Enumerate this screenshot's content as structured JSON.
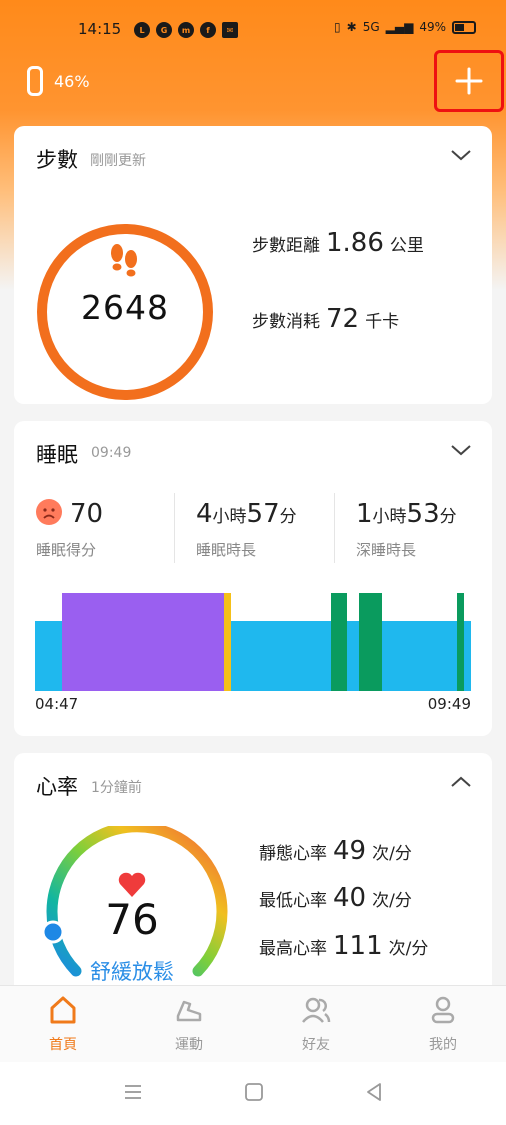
{
  "status_bar": {
    "time": "14:15",
    "notifications": [
      "line",
      "game",
      "messenger",
      "facebook",
      "mail"
    ],
    "network": "5G",
    "battery": "49%"
  },
  "header": {
    "band_battery": "46%",
    "add_icon": "plus-icon"
  },
  "steps_card": {
    "title": "步數",
    "updated": "剛剛更新",
    "count": "2648",
    "distance_label": "步數距離",
    "distance_value": "1.86",
    "distance_unit": "公里",
    "calories_label": "步數消耗",
    "calories_value": "72",
    "calories_unit": "千卡"
  },
  "sleep_card": {
    "title": "睡眠",
    "time": "09:49",
    "score": "70",
    "score_label": "睡眠得分",
    "duration_h": "4",
    "duration_h_unit": "小時",
    "duration_m": "57",
    "duration_m_unit": "分",
    "duration_label": "睡眠時長",
    "deep_h": "1",
    "deep_h_unit": "小時",
    "deep_m": "53",
    "deep_m_unit": "分",
    "deep_label": "深睡時長",
    "start_time": "04:47",
    "end_time": "09:49",
    "colors": {
      "light": "#1fb8ee",
      "deep": "#9a5ff0",
      "awake": "#f5c018",
      "rem": "#0a9b5e"
    }
  },
  "heart_card": {
    "title": "心率",
    "updated": "1分鐘前",
    "value": "76",
    "status": "舒緩放鬆",
    "resting_label": "靜態心率",
    "resting_value": "49",
    "resting_unit": "次/分",
    "min_label": "最低心率",
    "min_value": "40",
    "min_unit": "次/分",
    "max_label": "最高心率",
    "max_value": "111",
    "max_unit": "次/分"
  },
  "bottom_nav": {
    "items": [
      {
        "label": "首頁",
        "icon": "home-icon",
        "active": true
      },
      {
        "label": "運動",
        "icon": "shoe-icon",
        "active": false
      },
      {
        "label": "好友",
        "icon": "friends-icon",
        "active": false
      },
      {
        "label": "我的",
        "icon": "profile-icon",
        "active": false
      }
    ]
  },
  "accent_color": "#f07a1a"
}
